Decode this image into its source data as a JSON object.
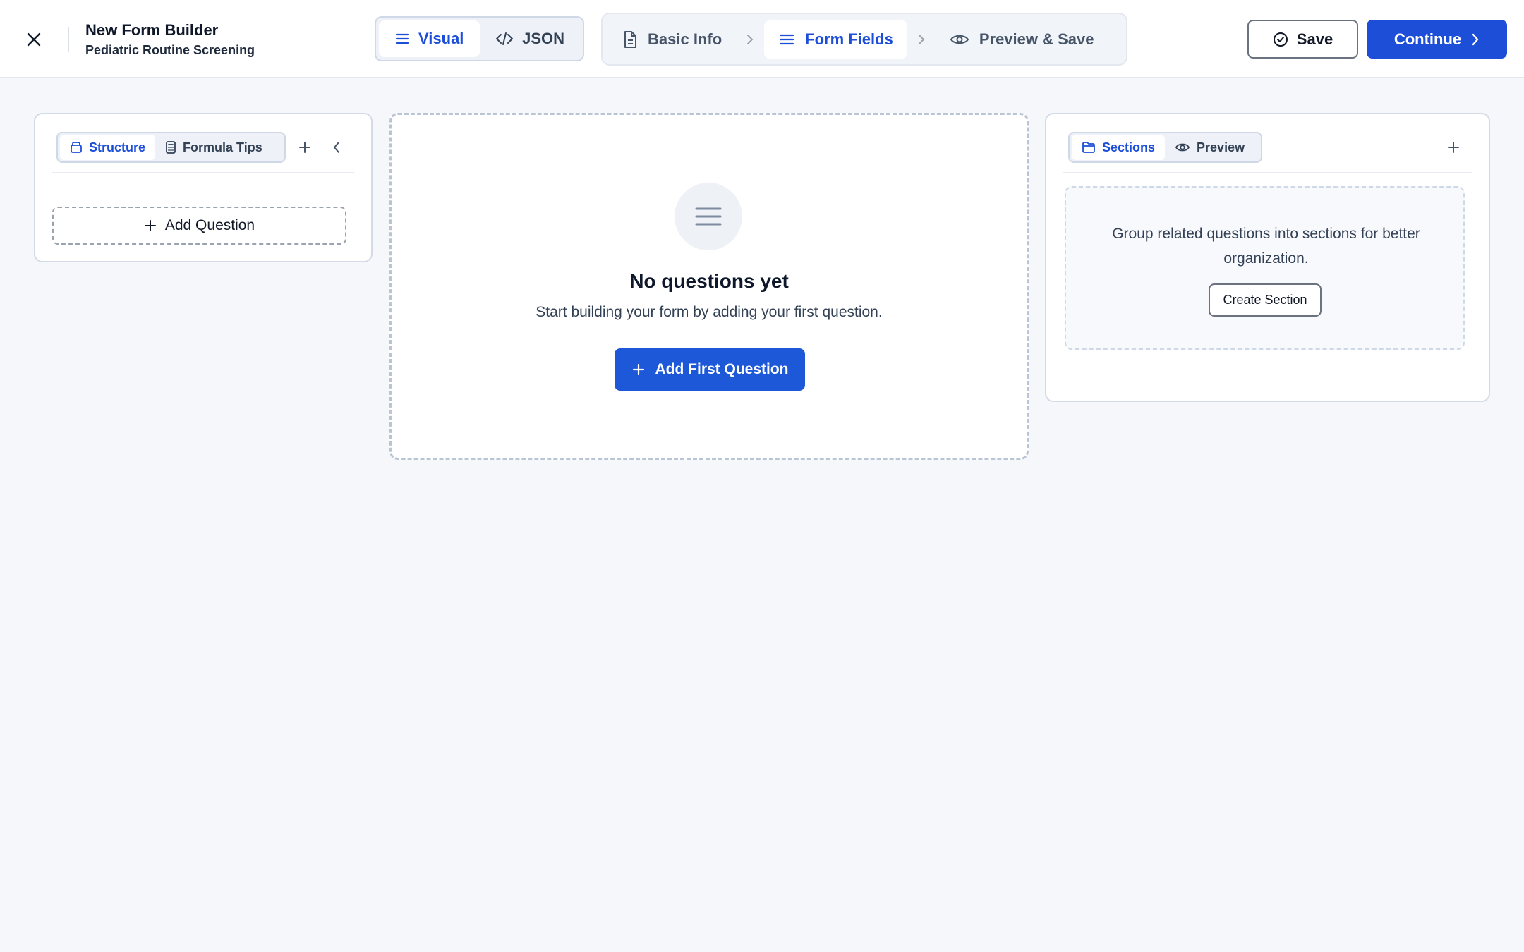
{
  "header": {
    "title": "New Form Builder",
    "subtitle": "Pediatric Routine Screening",
    "mode_toggle": {
      "visual": "Visual",
      "json": "JSON",
      "active": "visual"
    },
    "steps": [
      {
        "label": "Basic Info",
        "icon": "document-icon"
      },
      {
        "label": "Form Fields",
        "icon": "list-icon",
        "active": true
      },
      {
        "label": "Preview & Save",
        "icon": "eye-icon"
      }
    ],
    "save_label": "Save",
    "continue_label": "Continue"
  },
  "left_panel": {
    "tabs": [
      {
        "label": "Structure",
        "icon": "layers-icon",
        "active": true
      },
      {
        "label": "Formula Tips",
        "icon": "calculator-icon"
      }
    ],
    "add_question_label": "Add Question"
  },
  "center_panel": {
    "empty_title": "No questions yet",
    "empty_subtitle": "Start building your form by adding your first question.",
    "add_first_label": "Add First Question"
  },
  "right_panel": {
    "tabs": [
      {
        "label": "Sections",
        "icon": "folder-icon",
        "active": true
      },
      {
        "label": "Preview",
        "icon": "eye-icon"
      }
    ],
    "empty_message": "Group related questions into sections for better organization.",
    "create_section_label": "Create Section"
  },
  "colors": {
    "accent": "#1d4ed8",
    "background": "#f5f7fb",
    "border": "#d3dbe7"
  }
}
